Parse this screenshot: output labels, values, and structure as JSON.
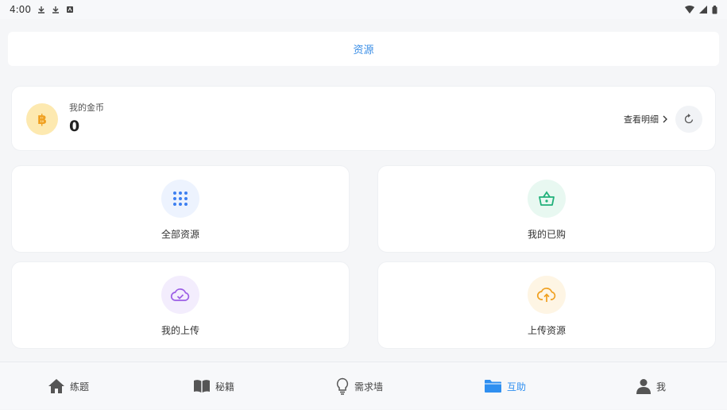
{
  "status_bar": {
    "time": "4:00"
  },
  "header": {
    "title": "资源"
  },
  "coins": {
    "label": "我的金币",
    "value": "0",
    "detail_label": "查看明细"
  },
  "tiles": [
    {
      "label": "全部资源",
      "icon": "grid-icon",
      "color": "#3d7ff0",
      "bg": "#edf3fe"
    },
    {
      "label": "我的已购",
      "icon": "basket-icon",
      "color": "#20b07a",
      "bg": "#e8f8f1"
    },
    {
      "label": "我的上传",
      "icon": "cloud-check-icon",
      "color": "#9b5de5",
      "bg": "#f3edfd"
    },
    {
      "label": "上传资源",
      "icon": "cloud-upload-icon",
      "color": "#f0a020",
      "bg": "#fef5e4"
    }
  ],
  "tabs": [
    {
      "label": "练题",
      "icon": "home-icon",
      "active": false
    },
    {
      "label": "秘籍",
      "icon": "book-icon",
      "active": false
    },
    {
      "label": "需求墙",
      "icon": "bulb-icon",
      "active": false
    },
    {
      "label": "互助",
      "icon": "folder-icon",
      "active": true
    },
    {
      "label": "我",
      "icon": "user-icon",
      "active": false
    }
  ],
  "colors": {
    "accent": "#2f8ff0",
    "coin_bg": "#fde9b0",
    "coin_symbol": "#f0a020"
  }
}
